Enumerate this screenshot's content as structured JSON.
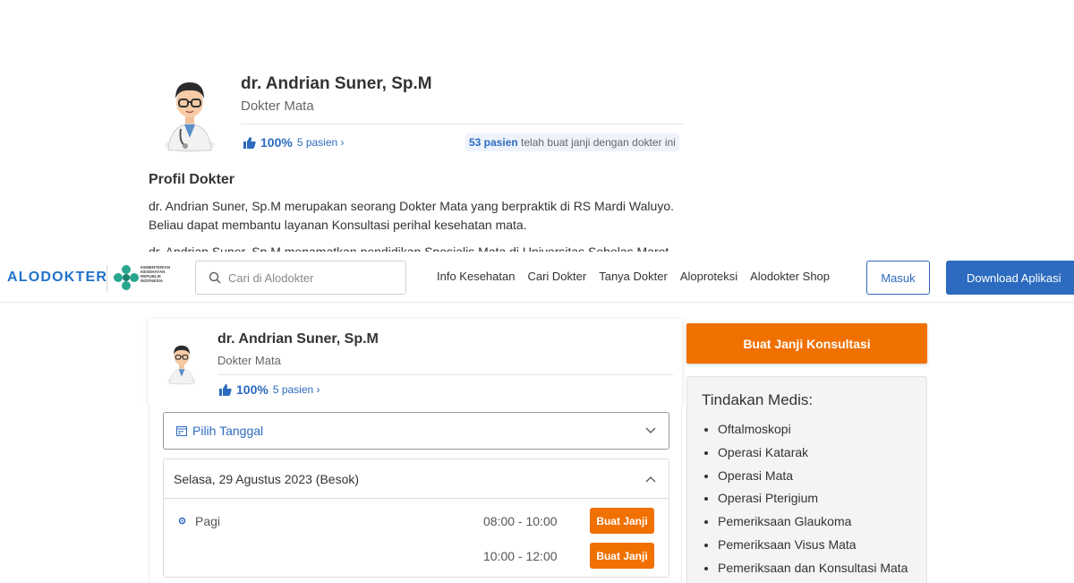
{
  "background": {
    "doctor_name": "dr. Andrian Suner, Sp.M",
    "specialty": "Dokter Mata",
    "rating_percent": "100%",
    "patients_link": "5 pasien ›",
    "appointments_count": "53 pasien",
    "appointments_text": " telah buat janji dengan dokter ini",
    "profile_title": "Profil Dokter",
    "description": "dr. Andrian Suner, Sp.M merupakan seorang Dokter Mata yang berpraktik di RS Mardi Waluyo. Beliau dapat membantu layanan Konsultasi perihal kesehatan mata.",
    "description_cut": "dr. Andrian Suner, Sp.M menamatkan pendidikan Spesialis Mata di Universitas Sebelas Maret"
  },
  "header": {
    "logo": "ALODOKTER",
    "kemenkes_text": "KEMENTERIAN KESEHATAN REPUBLIK INDONESIA",
    "search_placeholder": "Cari di Alodokter",
    "nav": [
      "Info Kesehatan",
      "Cari Dokter",
      "Tanya Dokter",
      "Aloproteksi",
      "Alodokter Shop"
    ],
    "login_label": "Masuk",
    "download_label": "Download Aplikasi"
  },
  "card": {
    "doctor_name": "dr. Andrian Suner, Sp.M",
    "specialty": "Dokter Mata",
    "rating_percent": "100%",
    "patients_link": "5 pasien ›"
  },
  "schedule": {
    "date_picker_label": "Pilih Tanggal",
    "day_label": "Selasa, 29 Agustus 2023 (Besok)",
    "session_label": "Pagi",
    "slots": [
      {
        "time": "08:00 - 10:00",
        "button": "Buat Janji"
      },
      {
        "time": "10:00 - 12:00",
        "button": "Buat Janji"
      }
    ]
  },
  "sidebar": {
    "cta_label": "Buat Janji Konsultasi",
    "medical_title": "Tindakan Medis:",
    "procedures": [
      "Oftalmoskopi",
      "Operasi Katarak",
      "Operasi Mata",
      "Operasi Pterigium",
      "Pemeriksaan Glaukoma",
      "Pemeriksaan Visus Mata",
      "Pemeriksaan dan Konsultasi Mata"
    ]
  },
  "colors": {
    "brand_blue": "#2c6bbf",
    "accent_orange": "#f07000"
  }
}
